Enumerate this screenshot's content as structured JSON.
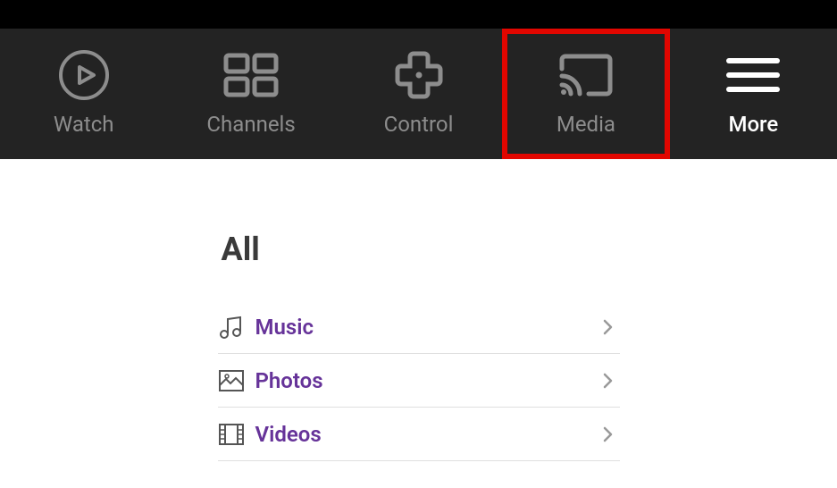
{
  "nav": {
    "items": [
      {
        "icon": "play-circle-icon",
        "label": "Watch",
        "active": false,
        "highlighted": false
      },
      {
        "icon": "grid-icon",
        "label": "Channels",
        "active": false,
        "highlighted": false
      },
      {
        "icon": "dpad-icon",
        "label": "Control",
        "active": false,
        "highlighted": false
      },
      {
        "icon": "cast-icon",
        "label": "Media",
        "active": false,
        "highlighted": true
      },
      {
        "icon": "menu-icon",
        "label": "More",
        "active": true,
        "highlighted": false
      }
    ]
  },
  "section": {
    "title": "All",
    "items": [
      {
        "icon": "music-icon",
        "label": "Music"
      },
      {
        "icon": "photo-icon",
        "label": "Photos"
      },
      {
        "icon": "video-icon",
        "label": "Videos"
      }
    ]
  }
}
